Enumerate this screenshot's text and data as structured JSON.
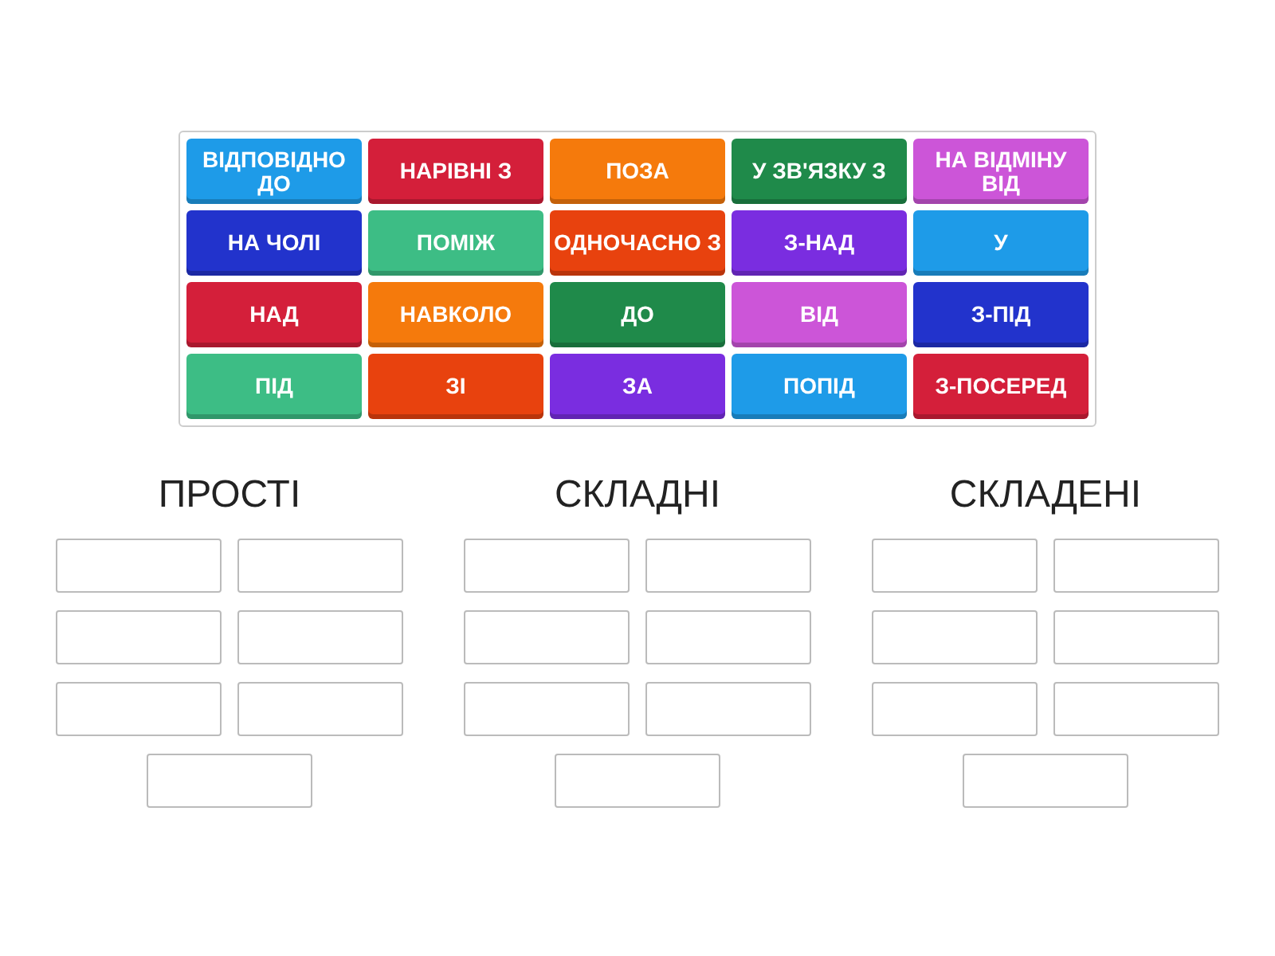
{
  "tiles": [
    {
      "label": "ВІДПОВІДНО ДО",
      "color": "#1e9be8"
    },
    {
      "label": "НАРІВНІ З",
      "color": "#d41f3a"
    },
    {
      "label": "ПОЗА",
      "color": "#f57a0c"
    },
    {
      "label": "У ЗВ'ЯЗКУ З",
      "color": "#1f8a4a"
    },
    {
      "label": "НА ВІДМІНУ ВІД",
      "color": "#cc55d8"
    },
    {
      "label": "НА ЧОЛІ",
      "color": "#2233cc"
    },
    {
      "label": "ПОМІЖ",
      "color": "#3dbd85"
    },
    {
      "label": "ОДНОЧАСНО З",
      "color": "#e8420e"
    },
    {
      "label": "З-НАД",
      "color": "#7a2de0"
    },
    {
      "label": "У",
      "color": "#1e9be8"
    },
    {
      "label": "НАД",
      "color": "#d41f3a"
    },
    {
      "label": "НАВКОЛО",
      "color": "#f57a0c"
    },
    {
      "label": "ДО",
      "color": "#1f8a4a"
    },
    {
      "label": "ВІД",
      "color": "#cc55d8"
    },
    {
      "label": "З-ПІД",
      "color": "#2233cc"
    },
    {
      "label": "ПІД",
      "color": "#3dbd85"
    },
    {
      "label": "ЗІ",
      "color": "#e8420e"
    },
    {
      "label": "ЗА",
      "color": "#7a2de0"
    },
    {
      "label": "ПОПІД",
      "color": "#1e9be8"
    },
    {
      "label": "З-ПОСЕРЕД",
      "color": "#d41f3a"
    }
  ],
  "groups": [
    {
      "title": "ПРОСТІ",
      "slots": [
        {
          "filled": false
        },
        {
          "filled": false
        },
        {
          "filled": false
        },
        {
          "filled": false
        },
        {
          "filled": false
        },
        {
          "filled": false
        },
        {
          "filled": false
        }
      ]
    },
    {
      "title": "СКЛАДНІ",
      "slots": [
        {
          "filled": false
        },
        {
          "filled": false
        },
        {
          "filled": false
        },
        {
          "filled": false
        },
        {
          "filled": false
        },
        {
          "filled": false
        },
        {
          "filled": false
        }
      ]
    },
    {
      "title": "СКЛАДЕНІ",
      "slots": [
        {
          "filled": false
        },
        {
          "filled": false
        },
        {
          "filled": false
        },
        {
          "filled": false
        },
        {
          "filled": false
        },
        {
          "filled": false
        },
        {
          "filled": false
        }
      ]
    }
  ]
}
